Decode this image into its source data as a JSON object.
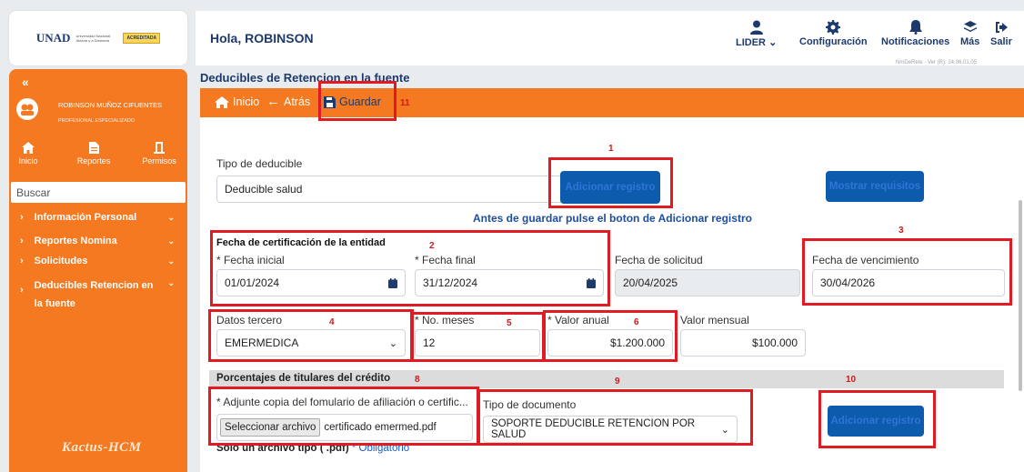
{
  "logo": {
    "text": "UNAD",
    "subtext": "Universidad Nacional Abierta y a Distancia",
    "badge": "ACREDITADA"
  },
  "sidebar": {
    "collapse_glyph": "«",
    "user_name": "ROBINSON MUÑOZ CIFUENTES",
    "user_role": "PROFESIONAL ESPECIALIZADO",
    "shortcuts": [
      {
        "label": "Inicio",
        "icon": "home-icon"
      },
      {
        "label": "Reportes",
        "icon": "document-icon"
      },
      {
        "label": "Permisos",
        "icon": "door-icon"
      }
    ],
    "search_placeholder": "Buscar",
    "menu": [
      {
        "label": "Información Personal"
      },
      {
        "label": "Reportes Nomina"
      },
      {
        "label": "Solicitudes"
      },
      {
        "label": "Deducibles Retencion en la fuente"
      }
    ],
    "footer_logo": "Kactus-HCM"
  },
  "header": {
    "greeting": "Hola, ROBINSON",
    "nav": [
      {
        "label": "LIDER",
        "icon": "user-icon"
      },
      {
        "label": "Configuración",
        "icon": "gear-icon"
      },
      {
        "label": "Notificaciones",
        "icon": "bell-icon"
      },
      {
        "label": "Más",
        "icon": "layers-icon"
      },
      {
        "label": "Salir",
        "icon": "logout-icon"
      }
    ],
    "version": "NmDeRete - Ver (R): 24.06.01.05"
  },
  "page": {
    "title": "Deducibles de Retencion en la fuente",
    "actions": {
      "home": "Inicio",
      "back": "Atrás",
      "save": "Guardar"
    }
  },
  "form": {
    "tipo_deducible_label": "Tipo de deducible",
    "tipo_deducible_value": "Deducible salud",
    "adicionar_registro_label": "Adicionar registro",
    "mostrar_requisitos_label": "Mostrar requisitos",
    "notice": "Antes de guardar pulse el boton de Adicionar registro",
    "cert_section_title": "Fecha de certificación de la entidad",
    "fecha_inicial_label": "* Fecha inicial",
    "fecha_inicial_value": "01/01/2024",
    "fecha_final_label": "* Fecha final",
    "fecha_final_value": "31/12/2024",
    "fecha_solicitud_label": "Fecha de solicitud",
    "fecha_solicitud_value": "20/04/2025",
    "fecha_vencimiento_label": "Fecha de vencimiento",
    "fecha_vencimiento_value": "30/04/2026",
    "datos_tercero_label": "Datos tercero",
    "datos_tercero_value": "EMERMEDICA",
    "no_meses_label": "* No. meses",
    "no_meses_value": "12",
    "valor_anual_label": "* Valor anual",
    "valor_anual_value": "$1.200.000",
    "valor_mensual_label": "Valor mensual",
    "valor_mensual_value": "$100.000",
    "porcentajes_title": "Porcentajes de titulares del crédito",
    "adjunte_label": "* Adjunte copia del fomulario de afiliación o certific...",
    "file_button_label": "Seleccionar archivo",
    "file_name": "certificado emermed.pdf",
    "tipo_documento_label": "Tipo de documento",
    "tipo_documento_value": "SOPORTE DEDUCIBLE RETENCION POR SALUD",
    "adicionar_registro2_label": "Adicionar registro",
    "pdf_note": "Solo un archivo tipo ( .pdf)",
    "obligatorio": "* Obligatorio"
  },
  "annotations": [
    "1",
    "2",
    "3",
    "4",
    "5",
    "6",
    "8",
    "9",
    "10",
    "11"
  ],
  "colors": {
    "orange": "#f47920",
    "navy": "#1e3a6d",
    "button_blue": "#0d5bad",
    "highlight_red": "#e11b23"
  }
}
